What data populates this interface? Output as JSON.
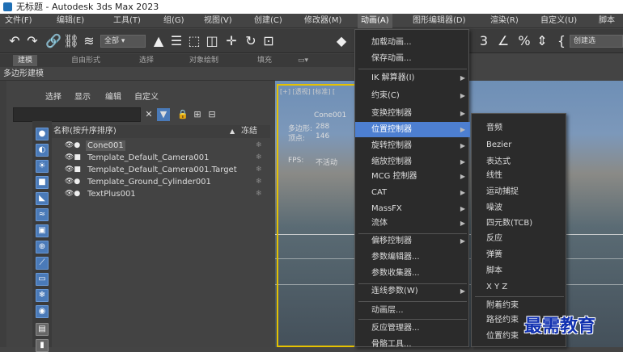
{
  "window": {
    "title": "无标题 - Autodesk 3ds Max 2023"
  },
  "menubar": {
    "items": [
      "文件(F)",
      "编辑(E)",
      "工具(T)",
      "组(G)",
      "视图(V)",
      "创建(C)",
      "修改器(M)",
      "动画(A)",
      "图形编辑器(D)",
      "渲染(R)",
      "自定义(U)",
      "脚本"
    ]
  },
  "toolbar": {
    "selection_filter": "全部",
    "named_selection": "创建选"
  },
  "ribbon_tabs": [
    "建模",
    "自由形式",
    "选择",
    "对象绘制",
    "填充"
  ],
  "ribbon_label": "多边形建模",
  "explorer": {
    "menus": [
      "选择",
      "显示",
      "编辑",
      "自定义"
    ],
    "search_placeholder": "",
    "column_name": "名称(按升序排序)",
    "column_sort": "▲",
    "column_frozen": "冻结",
    "rows": [
      {
        "name": "Cone001",
        "selected": true
      },
      {
        "name": "Template_Default_Camera001",
        "selected": false
      },
      {
        "name": "Template_Default_Camera001.Target",
        "selected": false
      },
      {
        "name": "Template_Ground_Cylinder001",
        "selected": false
      },
      {
        "name": "TextPlus001",
        "selected": false
      }
    ]
  },
  "viewport": {
    "label": "[+] [透视] [标准] [",
    "object_name": "Cone001",
    "poly_label": "多边形:",
    "poly_value": "288",
    "vert_label": "顶点:",
    "vert_value": "146",
    "fps_label": "FPS:",
    "fps_value": "不活动"
  },
  "animation_menu": {
    "items": [
      {
        "label": "加载动画...",
        "submenu": false
      },
      {
        "label": "保存动画...",
        "submenu": false
      },
      {
        "label": "IK 解算器(I)",
        "submenu": true
      },
      {
        "label": "约束(C)",
        "submenu": true
      },
      {
        "label": "变换控制器",
        "submenu": true
      },
      {
        "label": "位置控制器",
        "submenu": true,
        "highlighted": true
      },
      {
        "label": "旋转控制器",
        "submenu": true
      },
      {
        "label": "缩放控制器",
        "submenu": true
      },
      {
        "label": "MCG 控制器",
        "submenu": true
      },
      {
        "label": "CAT",
        "submenu": true
      },
      {
        "label": "MassFX",
        "submenu": true
      },
      {
        "label": "流体",
        "submenu": true
      },
      {
        "label": "偏移控制器",
        "submenu": true
      },
      {
        "label": "参数编辑器...",
        "submenu": false
      },
      {
        "label": "参数收集器...",
        "submenu": false
      },
      {
        "label": "连线参数(W)",
        "submenu": true
      },
      {
        "label": "动画层...",
        "submenu": false
      },
      {
        "label": "反应管理器...",
        "submenu": false
      },
      {
        "label": "骨骼工具...",
        "submenu": false
      }
    ]
  },
  "position_submenu": {
    "items": [
      "音频",
      "Bezier",
      "表达式",
      "线性",
      "运动捕捉",
      "噪波",
      "四元数(TCB)",
      "反应",
      "弹簧",
      "脚本",
      "X Y Z",
      "附着约束",
      "路径约束",
      "位置约束"
    ]
  },
  "watermark": "最需教育",
  "colors": {
    "highlight": "#4d7fd1",
    "menu_bg": "#2b2b2b",
    "viewport_border": "#e6c200"
  }
}
